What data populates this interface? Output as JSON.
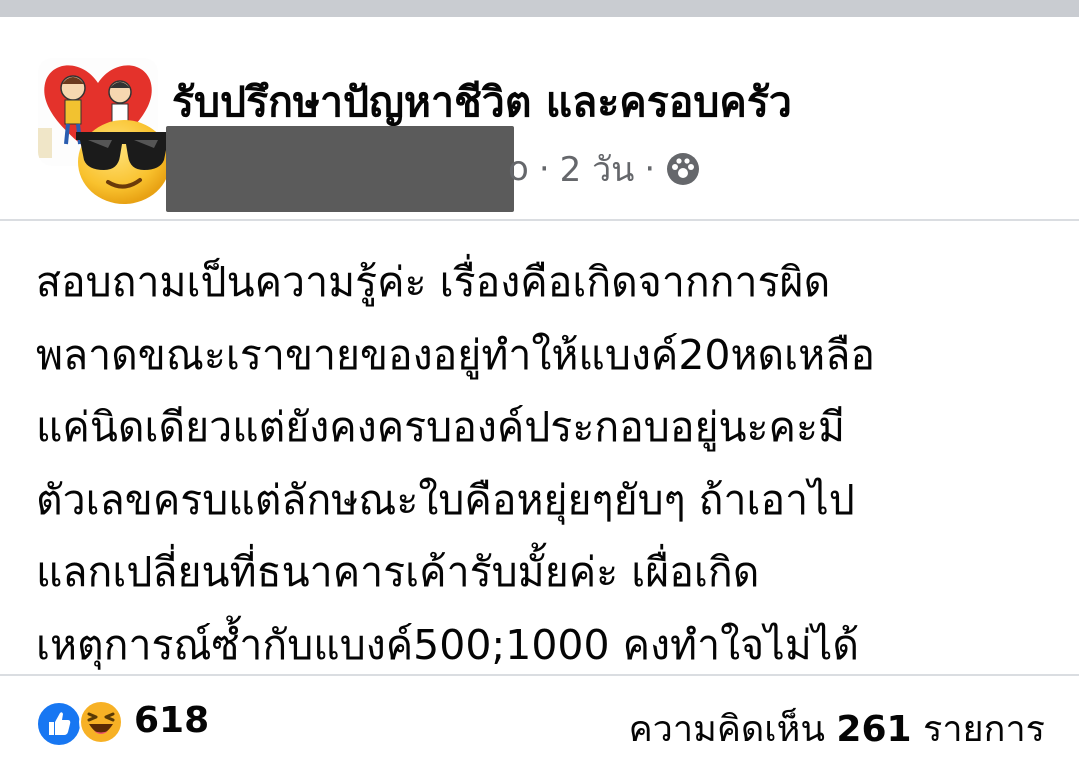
{
  "post": {
    "group_name": "รับปรึกษาปัญหาชีวิต และครอบครัว",
    "author_partial": "o",
    "time": "2 วัน",
    "separator": "·",
    "privacy_icon": "public-groups-icon",
    "body_lines": [
      "สอบถามเป็นความรู้ค่ะ เรื่องคือเกิดจากการผิด",
      "พลาดขณะเราขายของอยู่ทำให้แบงค์20หดเหลือ",
      "แค่นิดเดียวแต่ยังคงครบองค์ประกอบอยู่นะคะมี",
      "ตัวเลขครบแต่ลักษณะใบคือหยุ่ยๆยับๆ ถ้าเอาไป",
      "แลกเปลี่ยนที่ธนาคารเค้ารับมั้ยค่ะ เผื่อเกิด",
      "เหตุการณ์ซ้ำกับแบงค์500;1000 คงทำใจไม่ได้"
    ]
  },
  "footer": {
    "reaction_icons": [
      "like-icon",
      "haha-icon"
    ],
    "reaction_count": "618",
    "comments_label": "ความคิดเห็น",
    "comments_count": "261",
    "comments_suffix": "รายการ"
  },
  "colors": {
    "text": "#050505",
    "secondary": "#65676b",
    "like_blue": "#1877f2",
    "divider": "#dadde1",
    "top_strip": "#c9ccd1"
  }
}
